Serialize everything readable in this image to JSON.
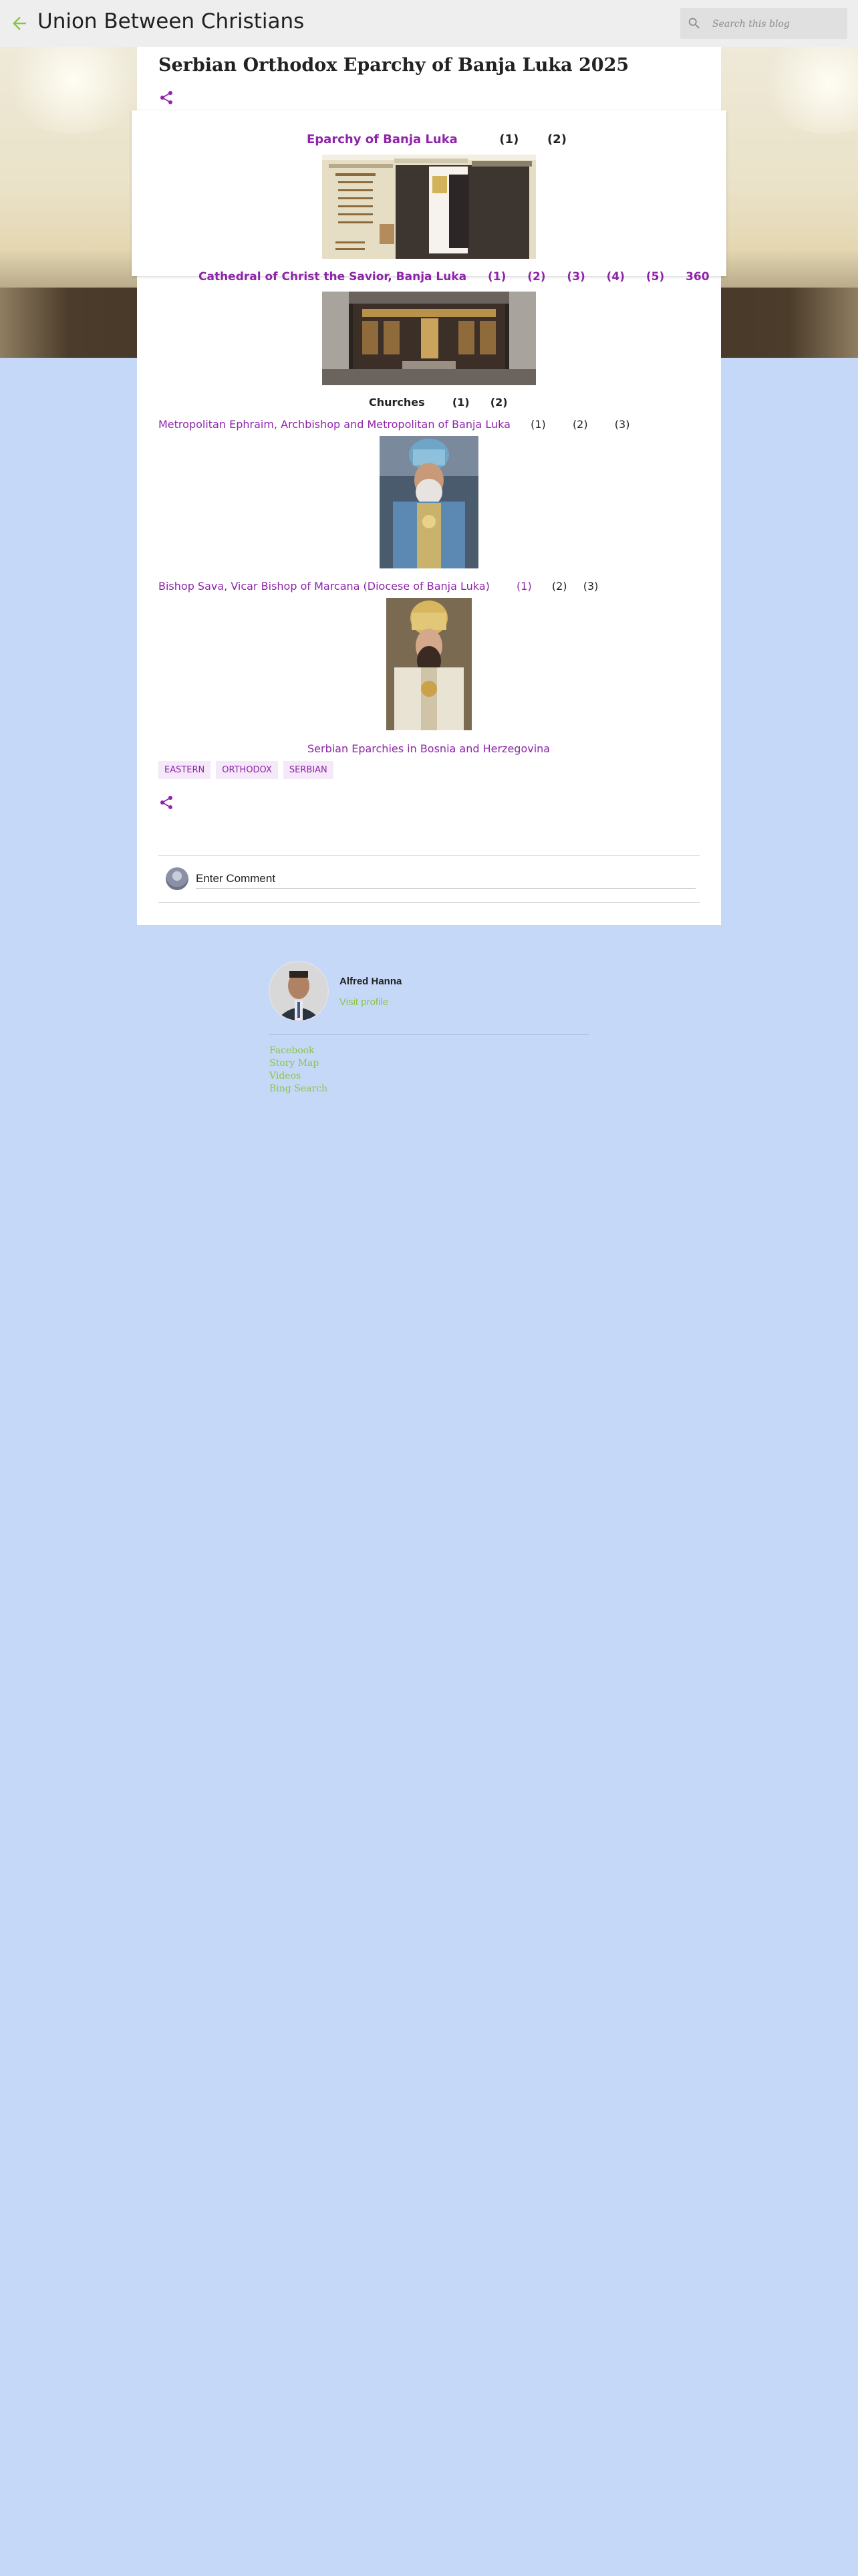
{
  "header": {
    "blog_title": "Union Between Christians",
    "search_placeholder": "Search this blog"
  },
  "post": {
    "title": "Serbian Orthodox Eparchy of Banja Luka 2025",
    "line1": {
      "link": "Eparchy of Banja Luka",
      "refs": [
        "(1)",
        "(2)"
      ]
    },
    "line2": {
      "link": "Cathedral of Christ the Savior, Banja Luka",
      "refs": [
        "(1)",
        "(2)",
        "(3)",
        "(4)",
        "(5)",
        "360"
      ]
    },
    "line3": {
      "label": "Churches",
      "refs": [
        "(1)",
        "(2)"
      ]
    },
    "line4": {
      "link": "Metropolitan Ephraim, Archbishop and Metropolitan of Banja Luka",
      "refs": [
        "(1)",
        "(2)",
        "(3)"
      ]
    },
    "line5": {
      "link": "Bishop Sava, Vicar Bishop of Marcana (Diocese of Banja Luka)",
      "link_ref": "(1)",
      "refs": [
        "(2)",
        "(3)"
      ]
    },
    "bottom_link": "Serbian Eparchies in Bosnia and Herzegovina",
    "labels": [
      "EASTERN",
      "ORTHODOX",
      "SERBIAN"
    ]
  },
  "comments": {
    "placeholder": "Enter Comment"
  },
  "profile": {
    "name": "Alfred Hanna",
    "visit": "Visit profile",
    "links": [
      "Facebook",
      "Story Map",
      "Videos",
      "Bing Search"
    ]
  },
  "colors": {
    "link": "#8e24aa",
    "accent_green": "#8bc34a",
    "page_background": "#c6d8f8",
    "header_background": "#eeeeee"
  },
  "icons": [
    "back-arrow-icon",
    "search-icon",
    "share-icon"
  ]
}
